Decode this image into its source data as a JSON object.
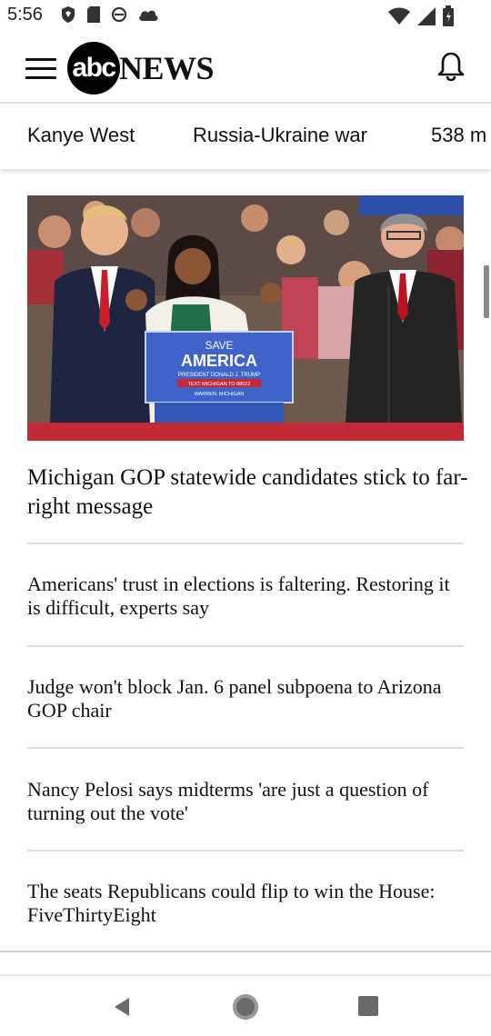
{
  "status_bar": {
    "time": "5:56",
    "icons_left": [
      "shield-icon",
      "sim-card-icon",
      "cycle-icon",
      "cloud-icon"
    ],
    "icons_right": [
      "wifi-icon",
      "cell-signal-icon",
      "battery-icon"
    ]
  },
  "header": {
    "logo_circle": "abc",
    "logo_word": "NEWS",
    "menu_icon": "hamburger-menu-icon",
    "bell_icon": "bell-icon"
  },
  "topics": [
    "Kanye West",
    "Russia-Ukraine war",
    "538 m"
  ],
  "hero": {
    "podium_line1": "SAVE",
    "podium_line2": "AMERICA",
    "podium_line3": "PRESIDENT DONALD J. TRUMP",
    "podium_line4": "TEXT MICHIGAN TO 88022",
    "podium_line5": "WARREN, MICHIGAN"
  },
  "articles": [
    {
      "title": "Michigan GOP statewide candidates stick to far-right message"
    },
    {
      "title": "Americans' trust in elections is faltering. Restoring it is difficult, experts say"
    },
    {
      "title": "Judge won't block Jan. 6 panel subpoena to Arizona GOP chair"
    },
    {
      "title": "Nancy Pelosi says midterms 'are just a question of turning out the vote'"
    },
    {
      "title": "The seats Republicans could flip to win the House: FiveThirtyEight"
    }
  ],
  "colors": {
    "accent_black": "#000000",
    "podium_blue": "#3f63c9",
    "stage_red": "#c42a36"
  },
  "nav": {
    "back_icon": "back-triangle-icon",
    "home_icon": "home-circle-icon",
    "recent_icon": "recent-apps-square-icon"
  }
}
